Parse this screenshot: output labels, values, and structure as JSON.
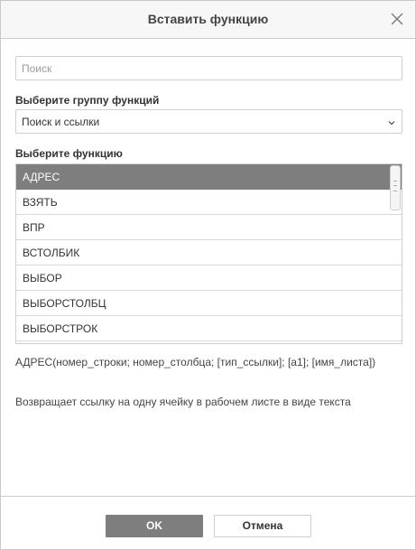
{
  "dialog": {
    "title": "Вставить функцию"
  },
  "search": {
    "placeholder": "Поиск",
    "value": ""
  },
  "group": {
    "label": "Выберите группу функций",
    "selected": "Поиск и ссылки"
  },
  "functions": {
    "label": "Выберите функцию",
    "items": [
      "АДРЕС",
      "ВЗЯТЬ",
      "ВПР",
      "ВСТОЛБИК",
      "ВЫБОР",
      "ВЫБОРСТОЛБЦ",
      "ВЫБОРСТРОК"
    ],
    "selected_index": 0
  },
  "info": {
    "syntax": "АДРЕС(номер_строки; номер_столбца; [тип_ссылки]; [a1]; [имя_листа])",
    "description": "Возвращает ссылку на одну ячейку в рабочем листе в виде текста"
  },
  "footer": {
    "ok_label": "OK",
    "cancel_label": "Отмена"
  },
  "colors": {
    "accent": "#7e7e7e",
    "header_bg": "#f7f7f7",
    "border": "#cfcfcf"
  },
  "icons": {
    "close": "close-icon",
    "dropdown": "chevron-down-icon"
  }
}
